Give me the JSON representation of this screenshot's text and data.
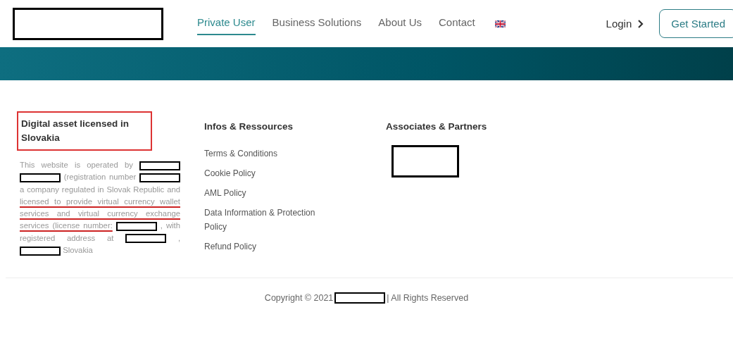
{
  "nav": {
    "links": [
      {
        "label": "Private User",
        "selected": true
      },
      {
        "label": "Business Solutions",
        "selected": false
      },
      {
        "label": "About Us",
        "selected": false
      },
      {
        "label": "Contact",
        "selected": false
      }
    ],
    "login": "Login",
    "cta": "Get Started"
  },
  "footer": {
    "about": {
      "title": "Digital asset licensed in Slovakia",
      "highlighted": true,
      "parts": [
        {
          "kind": "text",
          "text": "This website is operated by"
        },
        {
          "kind": "redacted"
        },
        {
          "kind": "redacted"
        },
        {
          "kind": "text",
          "text": "(registration number"
        },
        {
          "kind": "redacted"
        },
        {
          "kind": "text",
          "text": "a company regulated in Slovak Republic and"
        },
        {
          "kind": "underlined",
          "text": "licensed to provide virtual currency wallet services and virtual currency exchange services (license number:"
        },
        {
          "kind": "redacted"
        },
        {
          "kind": "text",
          "text": ", with registered address at"
        },
        {
          "kind": "redacted"
        },
        {
          "kind": "text",
          "text": ","
        },
        {
          "kind": "redacted"
        },
        {
          "kind": "text",
          "text": "Slovakia"
        }
      ]
    },
    "resources": {
      "title": "Infos & Ressources",
      "links": [
        "Terms & Conditions",
        "Cookie Policy",
        "AML Policy",
        "Data Information & Protection Policy",
        "Refund Policy"
      ]
    },
    "partners": {
      "title": "Associates & Partners"
    },
    "copyright": {
      "before": "Copyright © 2021",
      "after": "| All Rights Reserved"
    }
  }
}
